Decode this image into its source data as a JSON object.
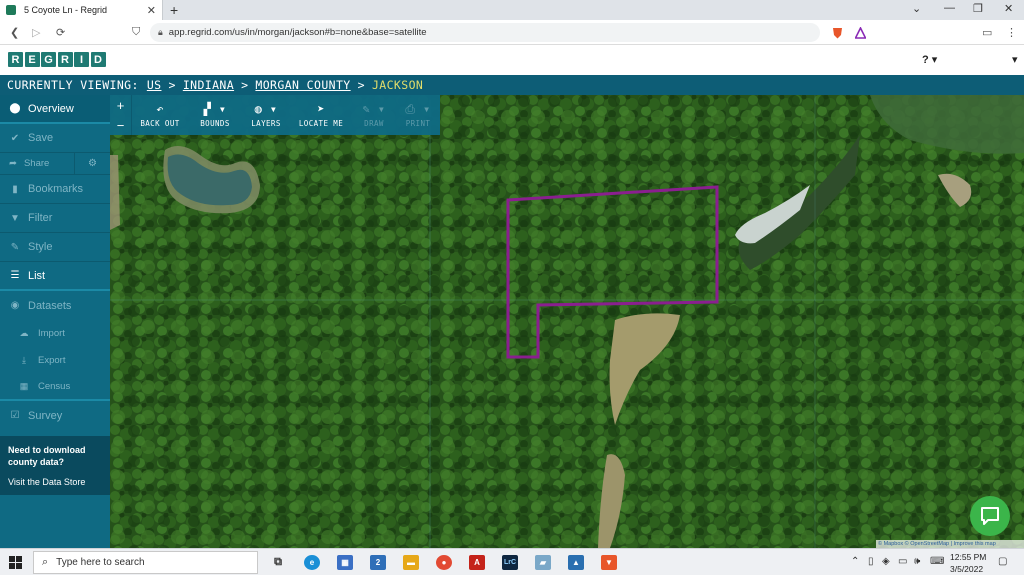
{
  "browser": {
    "tab_title": "5 Coyote Ln - Regrid",
    "url": "app.regrid.com/us/in/morgan/jackson#b=none&base=satellite"
  },
  "app": {
    "logo_letters": [
      "R",
      "E",
      "G",
      "R",
      "I",
      "D"
    ]
  },
  "breadcrumb": {
    "label": "CURRENTLY VIEWING:",
    "items": [
      "US",
      "INDIANA",
      "MORGAN COUNTY"
    ],
    "separator": ">",
    "current": "JACKSON"
  },
  "sidebar": {
    "overview": "Overview",
    "save": "Save",
    "share": "Share",
    "bookmarks": "Bookmarks",
    "filter": "Filter",
    "style": "Style",
    "list": "List",
    "datasets": "Datasets",
    "import": "Import",
    "export": "Export",
    "census": "Census",
    "survey": "Survey",
    "promo_title": "Need to download county data?",
    "promo_link": "Visit the Data Store"
  },
  "toolbar": {
    "zoom_in": "+",
    "zoom_out": "−",
    "back_out": "BACK OUT",
    "bounds": "BOUNDS",
    "layers": "LAYERS",
    "locate_me": "LOCATE ME",
    "draw": "DRAW",
    "print": "PRINT"
  },
  "map": {
    "attribution": "© Mapbox © OpenStreetMap | Improve this map",
    "parcel_color": "#8a1f8f"
  },
  "taskbar": {
    "search_placeholder": "Type here to search",
    "time": "12:55 PM",
    "date": "3/5/2022",
    "mail_badge": "2",
    "lrc_label": "LrC"
  },
  "colors": {
    "brand": "#1f7a73",
    "sidebar": "#0f6a83",
    "current_crumb": "#e2dd6b"
  }
}
